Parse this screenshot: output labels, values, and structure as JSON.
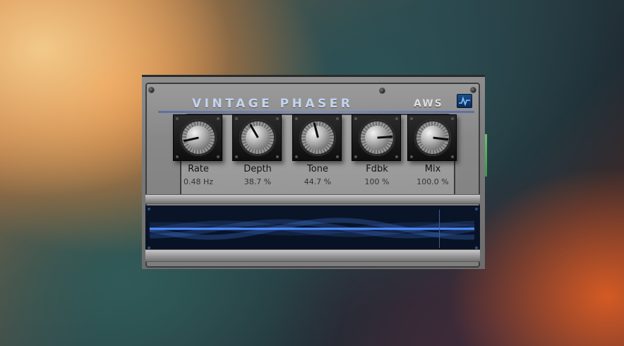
{
  "plugin": {
    "title": "VINTAGE PHASER",
    "brand": "AWS",
    "logo_icon": "waveform-logo-icon",
    "accent_color": "#c4d4f0",
    "scope_color": "#4d8cff"
  },
  "knobs": [
    {
      "label": "Rate",
      "value": "0.48 Hz",
      "position": 0.12
    },
    {
      "label": "Depth",
      "value": "38.7 %",
      "position": 0.387
    },
    {
      "label": "Tone",
      "value": "44.7 %",
      "position": 0.447
    },
    {
      "label": "Fdbk",
      "value": "100 %",
      "position": 0.82
    },
    {
      "label": "Mix",
      "value": "100.0 %",
      "position": 0.86
    }
  ]
}
